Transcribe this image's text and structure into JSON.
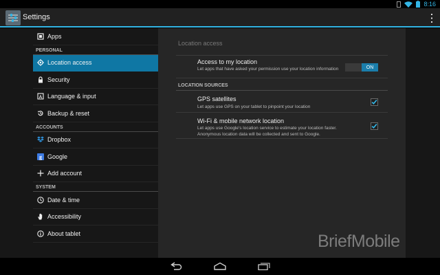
{
  "status_bar": {
    "time": "8:16",
    "icons": [
      "notification-icon",
      "wifi-icon",
      "battery-icon"
    ]
  },
  "action_bar": {
    "title": "Settings",
    "app_icon": "settings-icon",
    "overflow_icon": "overflow-menu-icon"
  },
  "sidebar": {
    "items": [
      {
        "label": "Apps",
        "icon": "apps-icon"
      },
      {
        "section": "PERSONAL"
      },
      {
        "label": "Location access",
        "icon": "location-icon",
        "selected": true
      },
      {
        "label": "Security",
        "icon": "lock-icon"
      },
      {
        "label": "Language & input",
        "icon": "language-icon"
      },
      {
        "label": "Backup & reset",
        "icon": "backup-icon"
      },
      {
        "section": "ACCOUNTS"
      },
      {
        "label": "Dropbox",
        "icon": "dropbox-icon"
      },
      {
        "label": "Google",
        "icon": "google-icon"
      },
      {
        "label": "Add account",
        "icon": "add-icon"
      },
      {
        "section": "SYSTEM"
      },
      {
        "label": "Date & time",
        "icon": "clock-icon"
      },
      {
        "label": "Accessibility",
        "icon": "hand-icon"
      },
      {
        "label": "About tablet",
        "icon": "info-icon"
      }
    ]
  },
  "detail": {
    "title": "Location access",
    "access": {
      "title": "Access to my location",
      "summary": "Let apps that have asked your permission use your location information",
      "toggle": "ON"
    },
    "section_label": "LOCATION SOURCES",
    "gps": {
      "title": "GPS satellites",
      "summary": "Let apps use GPS on your tablet to pinpoint your location",
      "checked": true
    },
    "network": {
      "title": "Wi-Fi & mobile network location",
      "summary": "Let apps use Google's location service to estimate your location faster. Anonymous location data will be collected and sent to Google.",
      "checked": true
    }
  },
  "watermark": "BriefMobile",
  "nav_bar": {
    "buttons": [
      "back-icon",
      "home-icon",
      "recents-icon"
    ]
  },
  "colors": {
    "accent": "#33b5e5",
    "selected": "#0f77a4",
    "toggle_on": "#1b7eab"
  }
}
